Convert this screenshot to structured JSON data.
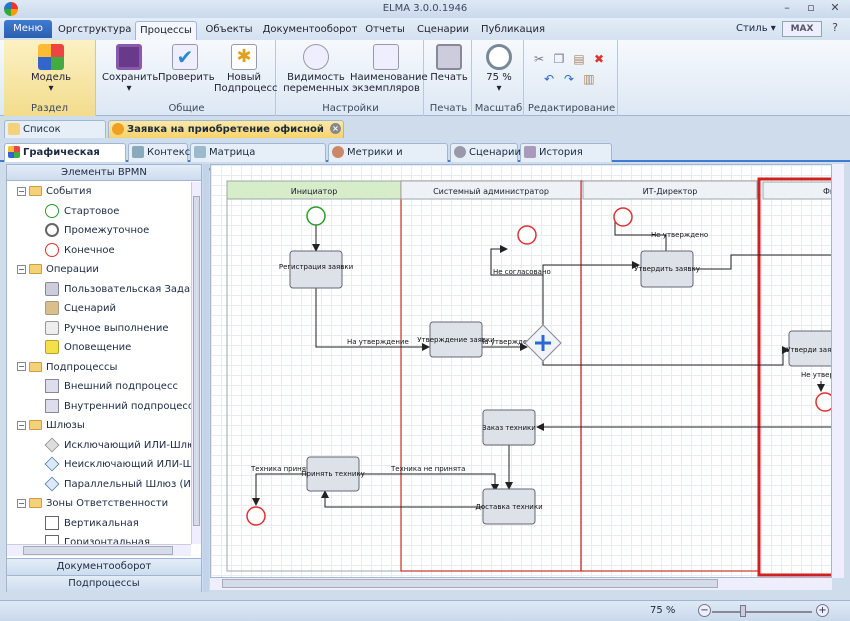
{
  "window": {
    "title": "ELMA 3.0.0.1946"
  },
  "menu": {
    "menu_button": "Меню",
    "tabs": [
      "Оргструктура",
      "Процессы",
      "Объекты",
      "Документооборот",
      "Отчеты",
      "Сценарии",
      "Публикация"
    ],
    "active_tab": "Процессы",
    "style_label": "Стиль",
    "max_label": "MAX"
  },
  "ribbon": {
    "groups": {
      "section": "Раздел",
      "general": "Общие",
      "settings": "Настройки",
      "print": "Печать",
      "scale": "Масштаб",
      "edit": "Редактирование"
    },
    "buttons": {
      "model": "Модель",
      "save": "Сохранить",
      "check": "Проверить",
      "new_subprocess_1": "Новый",
      "new_subprocess_2": "Подпроцесс",
      "vars_1": "Видимость",
      "vars_2": "переменных",
      "inst_1": "Наименование",
      "inst_2": "экземпляров",
      "print": "Печать",
      "zoom": "75 %"
    }
  },
  "doc_tabs": [
    "Список процессов",
    "Заявка на приобретение офисной техники *"
  ],
  "sub_tabs": [
    "Графическая модель",
    "Контекст",
    "Матрица ответственности",
    "Метрики и показатели",
    "Сценарии",
    "История версий"
  ],
  "left_panel": {
    "header": "Элементы BPMN",
    "tree": [
      {
        "type": "folder",
        "label": "События"
      },
      {
        "type": "leaf",
        "icon": "start-event-icon",
        "label": "Стартовое"
      },
      {
        "type": "leaf",
        "icon": "intermediate-event-icon",
        "label": "Промежуточное"
      },
      {
        "type": "leaf",
        "icon": "end-event-icon",
        "label": "Конечное"
      },
      {
        "type": "folder",
        "label": "Операции"
      },
      {
        "type": "leaf",
        "icon": "user-task-icon",
        "label": "Пользовательская Задача"
      },
      {
        "type": "leaf",
        "icon": "script-icon",
        "label": "Сценарий"
      },
      {
        "type": "leaf",
        "icon": "manual-icon",
        "label": "Ручное выполнение"
      },
      {
        "type": "leaf",
        "icon": "notification-icon",
        "label": "Оповещение"
      },
      {
        "type": "folder",
        "label": "Подпроцессы"
      },
      {
        "type": "leaf",
        "icon": "external-subprocess-icon",
        "label": "Внешний подпроцесс"
      },
      {
        "type": "leaf",
        "icon": "internal-subprocess-icon",
        "label": "Внутренний подпроцесс"
      },
      {
        "type": "folder",
        "label": "Шлюзы"
      },
      {
        "type": "leaf",
        "icon": "exclusive-gateway-icon",
        "label": "Исключающий ИЛИ-Шлюз"
      },
      {
        "type": "leaf",
        "icon": "inclusive-gateway-icon",
        "label": "Неисключающий ИЛИ-Шлюз"
      },
      {
        "type": "leaf",
        "icon": "parallel-gateway-icon",
        "label": "Параллельный Шлюз (И-Шлюз)"
      },
      {
        "type": "folder",
        "label": "Зоны Ответственности"
      },
      {
        "type": "leaf",
        "icon": "vertical-lane-icon",
        "label": "Вертикальная"
      },
      {
        "type": "leaf",
        "icon": "horizontal-lane-icon",
        "label": "Горизонтальная"
      }
    ],
    "footer_1": "Документооборот",
    "footer_2": "Подпроцессы"
  },
  "diagram": {
    "lanes": [
      "Инициатор",
      "Системный администратор",
      "ИТ-Директор",
      "Фина"
    ],
    "tasks": {
      "register": "Регистрация заявки",
      "approve": "Утверждение заявки",
      "itapprove": "Утвердить заявку",
      "finapprove": "Утверди заявку",
      "order": "Заказ техники",
      "accept": "Принять технику",
      "delivery": "Доставка техники"
    },
    "flow_labels": {
      "to_approval": "На утверждение",
      "to_approval2": "На утверждение",
      "not_agreed": "Не согласовано",
      "not_approved": "Не утверждено",
      "not_approved2": "Не утвер",
      "accepted": "Техника принята",
      "not_accepted": "Техника не принята"
    }
  },
  "status": {
    "zoom": "75 %"
  },
  "colors": {
    "accent": "#3f7bd0",
    "highlight": "#d02020",
    "task_fill": "#dde2e8"
  }
}
